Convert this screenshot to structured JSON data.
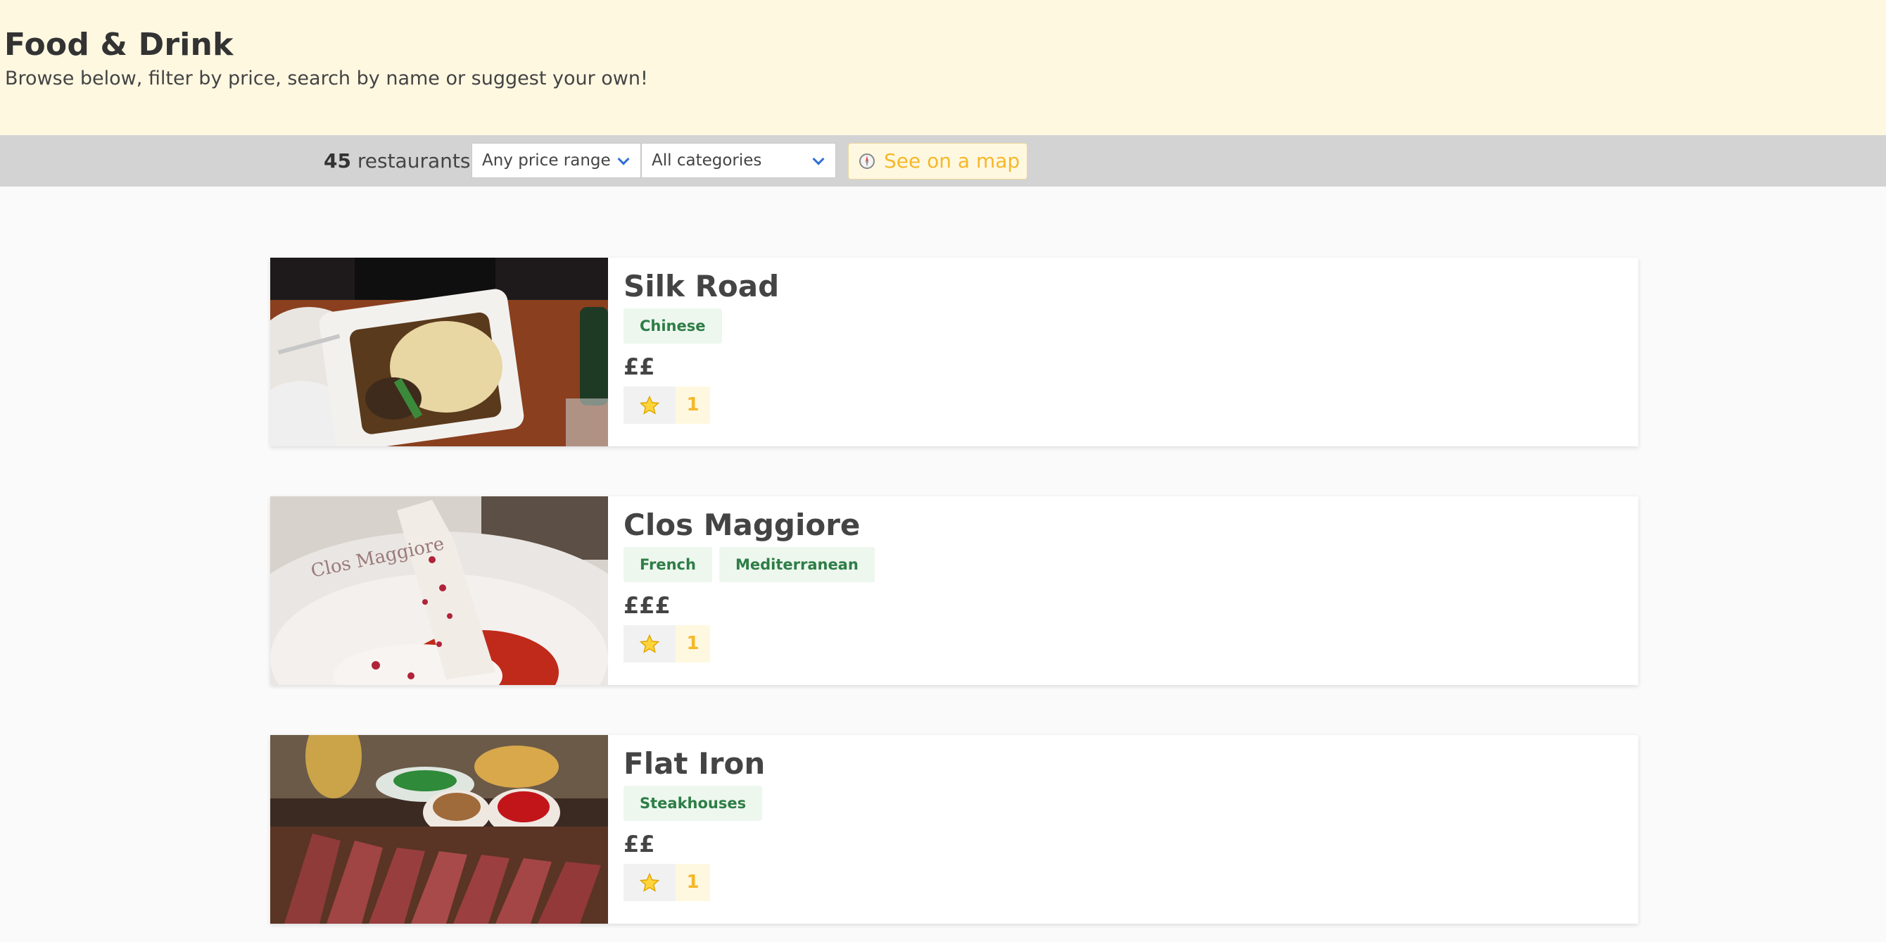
{
  "header": {
    "title": "Food & Drink",
    "subtitle": "Browse below, filter by price, search by name or suggest your own!"
  },
  "filters": {
    "count_number": "45",
    "count_label": " restaurants",
    "price_select": "Any price range",
    "category_select": "All categories",
    "map_button": "See on a map"
  },
  "colors": {
    "hero_bg": "#fff8e1",
    "filter_bar": "#d3d3d3",
    "tag_text": "#2e7d46",
    "tag_bg": "#edf7ee",
    "accent_yellow": "#f5b829",
    "chevron_blue": "#2f6fd6"
  },
  "restaurants": [
    {
      "name": "Silk Road",
      "tags": [
        "Chinese"
      ],
      "price": "££",
      "rating_icon": "star-icon",
      "rating": "1"
    },
    {
      "name": "Clos Maggiore",
      "tags": [
        "French",
        "Mediterranean"
      ],
      "price": "£££",
      "rating_icon": "star-icon",
      "rating": "1"
    },
    {
      "name": "Flat Iron",
      "tags": [
        "Steakhouses"
      ],
      "price": "££",
      "rating_icon": "star-icon",
      "rating": "1"
    }
  ]
}
